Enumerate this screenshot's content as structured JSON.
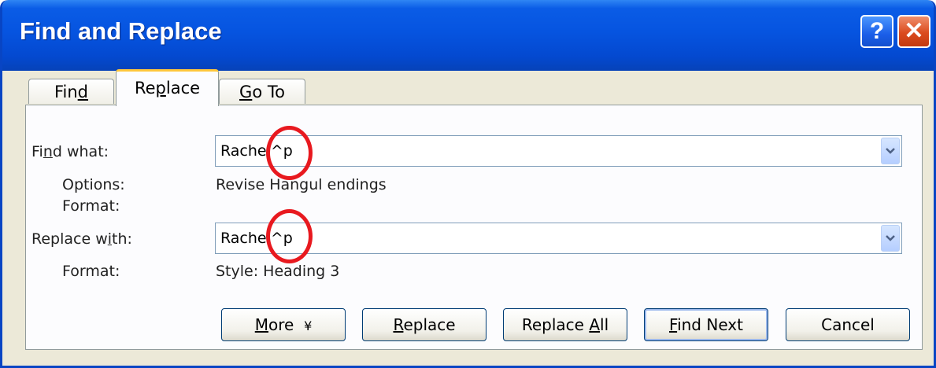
{
  "window": {
    "title": "Find and Replace",
    "help_glyph": "?",
    "close_glyph": "✕"
  },
  "tabs": [
    {
      "label_pre": "Fin",
      "label_key": "d",
      "label_post": "",
      "active": false
    },
    {
      "label_pre": "Re",
      "label_key": "p",
      "label_post": "lace",
      "active": true
    },
    {
      "label_pre": "",
      "label_key": "G",
      "label_post": "o To",
      "active": false
    }
  ],
  "find": {
    "label_pre": "Fi",
    "label_key": "n",
    "label_post": "d what:",
    "value": "Rachel^p",
    "options_label": "Options:",
    "options_value": "Revise Hangul endings",
    "format_label": "Format:",
    "format_value": ""
  },
  "replace": {
    "label_pre": "Replace w",
    "label_key": "i",
    "label_post": "th:",
    "value": "Rachel^p",
    "format_label": "Format:",
    "format_value": "Style: Heading 3"
  },
  "buttons": {
    "more_key": "M",
    "more_rest": "ore",
    "more_arrow": "¥",
    "replace_key": "R",
    "replace_rest": "eplace",
    "replace_all_pre": "Replace ",
    "replace_all_key": "A",
    "replace_all_rest": "ll",
    "find_next_key": "F",
    "find_next_rest": "ind Next",
    "cancel": "Cancel"
  },
  "colors": {
    "titlebar": "#0654e0",
    "annotation_circle": "#e8191f",
    "active_tab_highlight": "#ffc83c"
  }
}
